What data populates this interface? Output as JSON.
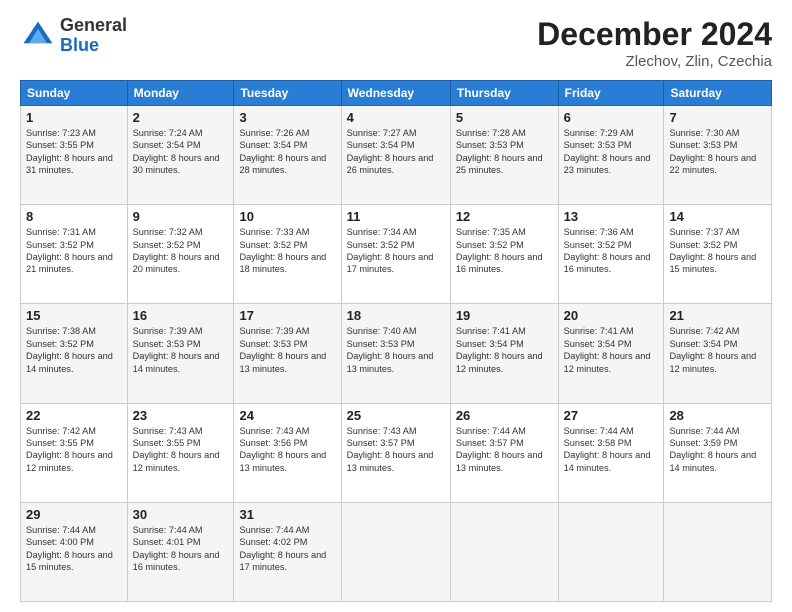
{
  "header": {
    "logo": {
      "general": "General",
      "blue": "Blue"
    },
    "title": "December 2024",
    "subtitle": "Zlechov, Zlin, Czechia"
  },
  "weekdays": [
    "Sunday",
    "Monday",
    "Tuesday",
    "Wednesday",
    "Thursday",
    "Friday",
    "Saturday"
  ],
  "weeks": [
    [
      {
        "day": 1,
        "sunrise": "7:23 AM",
        "sunset": "3:55 PM",
        "daylight": "8 hours and 31 minutes."
      },
      {
        "day": 2,
        "sunrise": "7:24 AM",
        "sunset": "3:54 PM",
        "daylight": "8 hours and 30 minutes."
      },
      {
        "day": 3,
        "sunrise": "7:26 AM",
        "sunset": "3:54 PM",
        "daylight": "8 hours and 28 minutes."
      },
      {
        "day": 4,
        "sunrise": "7:27 AM",
        "sunset": "3:54 PM",
        "daylight": "8 hours and 26 minutes."
      },
      {
        "day": 5,
        "sunrise": "7:28 AM",
        "sunset": "3:53 PM",
        "daylight": "8 hours and 25 minutes."
      },
      {
        "day": 6,
        "sunrise": "7:29 AM",
        "sunset": "3:53 PM",
        "daylight": "8 hours and 23 minutes."
      },
      {
        "day": 7,
        "sunrise": "7:30 AM",
        "sunset": "3:53 PM",
        "daylight": "8 hours and 22 minutes."
      }
    ],
    [
      {
        "day": 8,
        "sunrise": "7:31 AM",
        "sunset": "3:52 PM",
        "daylight": "8 hours and 21 minutes."
      },
      {
        "day": 9,
        "sunrise": "7:32 AM",
        "sunset": "3:52 PM",
        "daylight": "8 hours and 20 minutes."
      },
      {
        "day": 10,
        "sunrise": "7:33 AM",
        "sunset": "3:52 PM",
        "daylight": "8 hours and 18 minutes."
      },
      {
        "day": 11,
        "sunrise": "7:34 AM",
        "sunset": "3:52 PM",
        "daylight": "8 hours and 17 minutes."
      },
      {
        "day": 12,
        "sunrise": "7:35 AM",
        "sunset": "3:52 PM",
        "daylight": "8 hours and 16 minutes."
      },
      {
        "day": 13,
        "sunrise": "7:36 AM",
        "sunset": "3:52 PM",
        "daylight": "8 hours and 16 minutes."
      },
      {
        "day": 14,
        "sunrise": "7:37 AM",
        "sunset": "3:52 PM",
        "daylight": "8 hours and 15 minutes."
      }
    ],
    [
      {
        "day": 15,
        "sunrise": "7:38 AM",
        "sunset": "3:52 PM",
        "daylight": "8 hours and 14 minutes."
      },
      {
        "day": 16,
        "sunrise": "7:39 AM",
        "sunset": "3:53 PM",
        "daylight": "8 hours and 14 minutes."
      },
      {
        "day": 17,
        "sunrise": "7:39 AM",
        "sunset": "3:53 PM",
        "daylight": "8 hours and 13 minutes."
      },
      {
        "day": 18,
        "sunrise": "7:40 AM",
        "sunset": "3:53 PM",
        "daylight": "8 hours and 13 minutes."
      },
      {
        "day": 19,
        "sunrise": "7:41 AM",
        "sunset": "3:54 PM",
        "daylight": "8 hours and 12 minutes."
      },
      {
        "day": 20,
        "sunrise": "7:41 AM",
        "sunset": "3:54 PM",
        "daylight": "8 hours and 12 minutes."
      },
      {
        "day": 21,
        "sunrise": "7:42 AM",
        "sunset": "3:54 PM",
        "daylight": "8 hours and 12 minutes."
      }
    ],
    [
      {
        "day": 22,
        "sunrise": "7:42 AM",
        "sunset": "3:55 PM",
        "daylight": "8 hours and 12 minutes."
      },
      {
        "day": 23,
        "sunrise": "7:43 AM",
        "sunset": "3:55 PM",
        "daylight": "8 hours and 12 minutes."
      },
      {
        "day": 24,
        "sunrise": "7:43 AM",
        "sunset": "3:56 PM",
        "daylight": "8 hours and 13 minutes."
      },
      {
        "day": 25,
        "sunrise": "7:43 AM",
        "sunset": "3:57 PM",
        "daylight": "8 hours and 13 minutes."
      },
      {
        "day": 26,
        "sunrise": "7:44 AM",
        "sunset": "3:57 PM",
        "daylight": "8 hours and 13 minutes."
      },
      {
        "day": 27,
        "sunrise": "7:44 AM",
        "sunset": "3:58 PM",
        "daylight": "8 hours and 14 minutes."
      },
      {
        "day": 28,
        "sunrise": "7:44 AM",
        "sunset": "3:59 PM",
        "daylight": "8 hours and 14 minutes."
      }
    ],
    [
      {
        "day": 29,
        "sunrise": "7:44 AM",
        "sunset": "4:00 PM",
        "daylight": "8 hours and 15 minutes."
      },
      {
        "day": 30,
        "sunrise": "7:44 AM",
        "sunset": "4:01 PM",
        "daylight": "8 hours and 16 minutes."
      },
      {
        "day": 31,
        "sunrise": "7:44 AM",
        "sunset": "4:02 PM",
        "daylight": "8 hours and 17 minutes."
      },
      null,
      null,
      null,
      null
    ]
  ]
}
